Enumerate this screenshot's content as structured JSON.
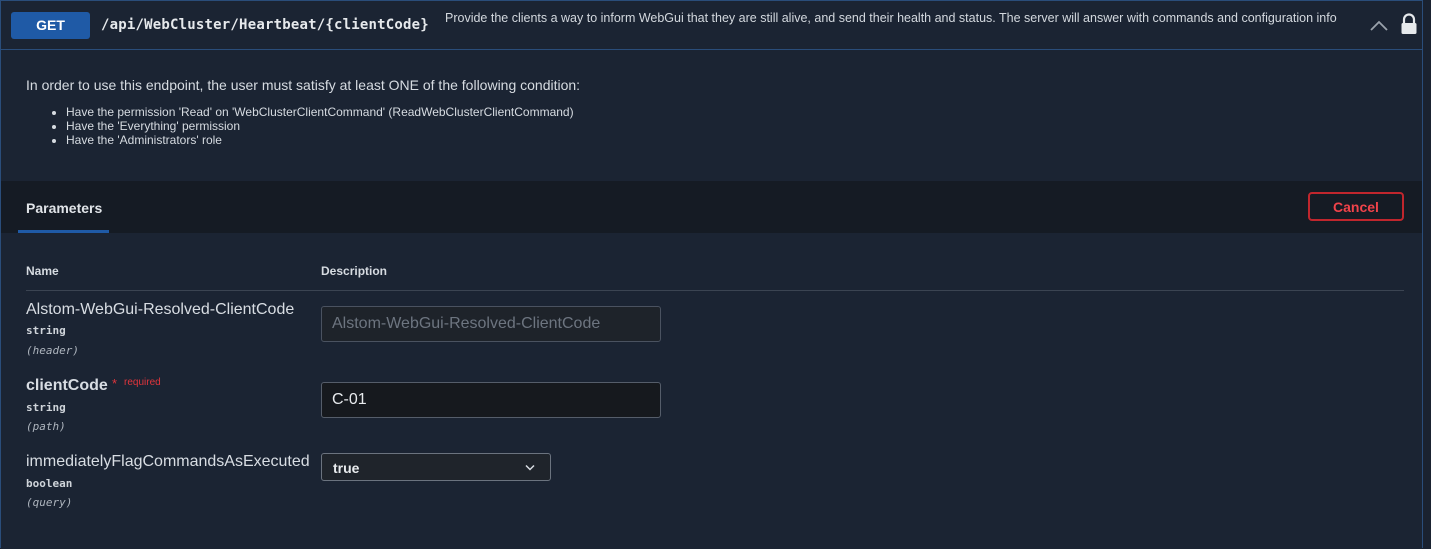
{
  "operation": {
    "method": "GET",
    "path": "/api/WebCluster/Heartbeat/{clientCode}",
    "summary": "Provide the clients a way to inform WebGui that they are still alive, and send their health and status. The server will answer with commands and configuration info"
  },
  "authorization": {
    "intro": "In order to use this endpoint, the user must satisfy at least ONE of the following condition:",
    "conditions": [
      "Have the permission 'Read' on 'WebClusterClientCommand' (ReadWebClusterClientCommand)",
      "Have the 'Everything' permission",
      "Have the 'Administrators' role"
    ]
  },
  "parameters_section": {
    "tab_label": "Parameters",
    "cancel_label": "Cancel",
    "col_name": "Name",
    "col_description": "Description"
  },
  "parameters": [
    {
      "name": "Alstom-WebGui-Resolved-ClientCode",
      "type": "string",
      "in": "(header)",
      "value": "",
      "placeholder": "Alstom-WebGui-Resolved-ClientCode"
    },
    {
      "name": "clientCode",
      "required_star": "*",
      "required_label": "required",
      "type": "string",
      "in": "(path)",
      "value": "C-01"
    },
    {
      "name": "immediatelyFlagCommandsAsExecuted",
      "type": "boolean",
      "in": "(query)",
      "selected": "true"
    }
  ],
  "icons": {
    "collapse": "chevron-up-icon",
    "auth": "lock-icon",
    "select": "chevron-down-icon"
  },
  "colors": {
    "method_get": "#1f5aa6",
    "cancel": "#c0262d",
    "required": "#e0353c"
  }
}
